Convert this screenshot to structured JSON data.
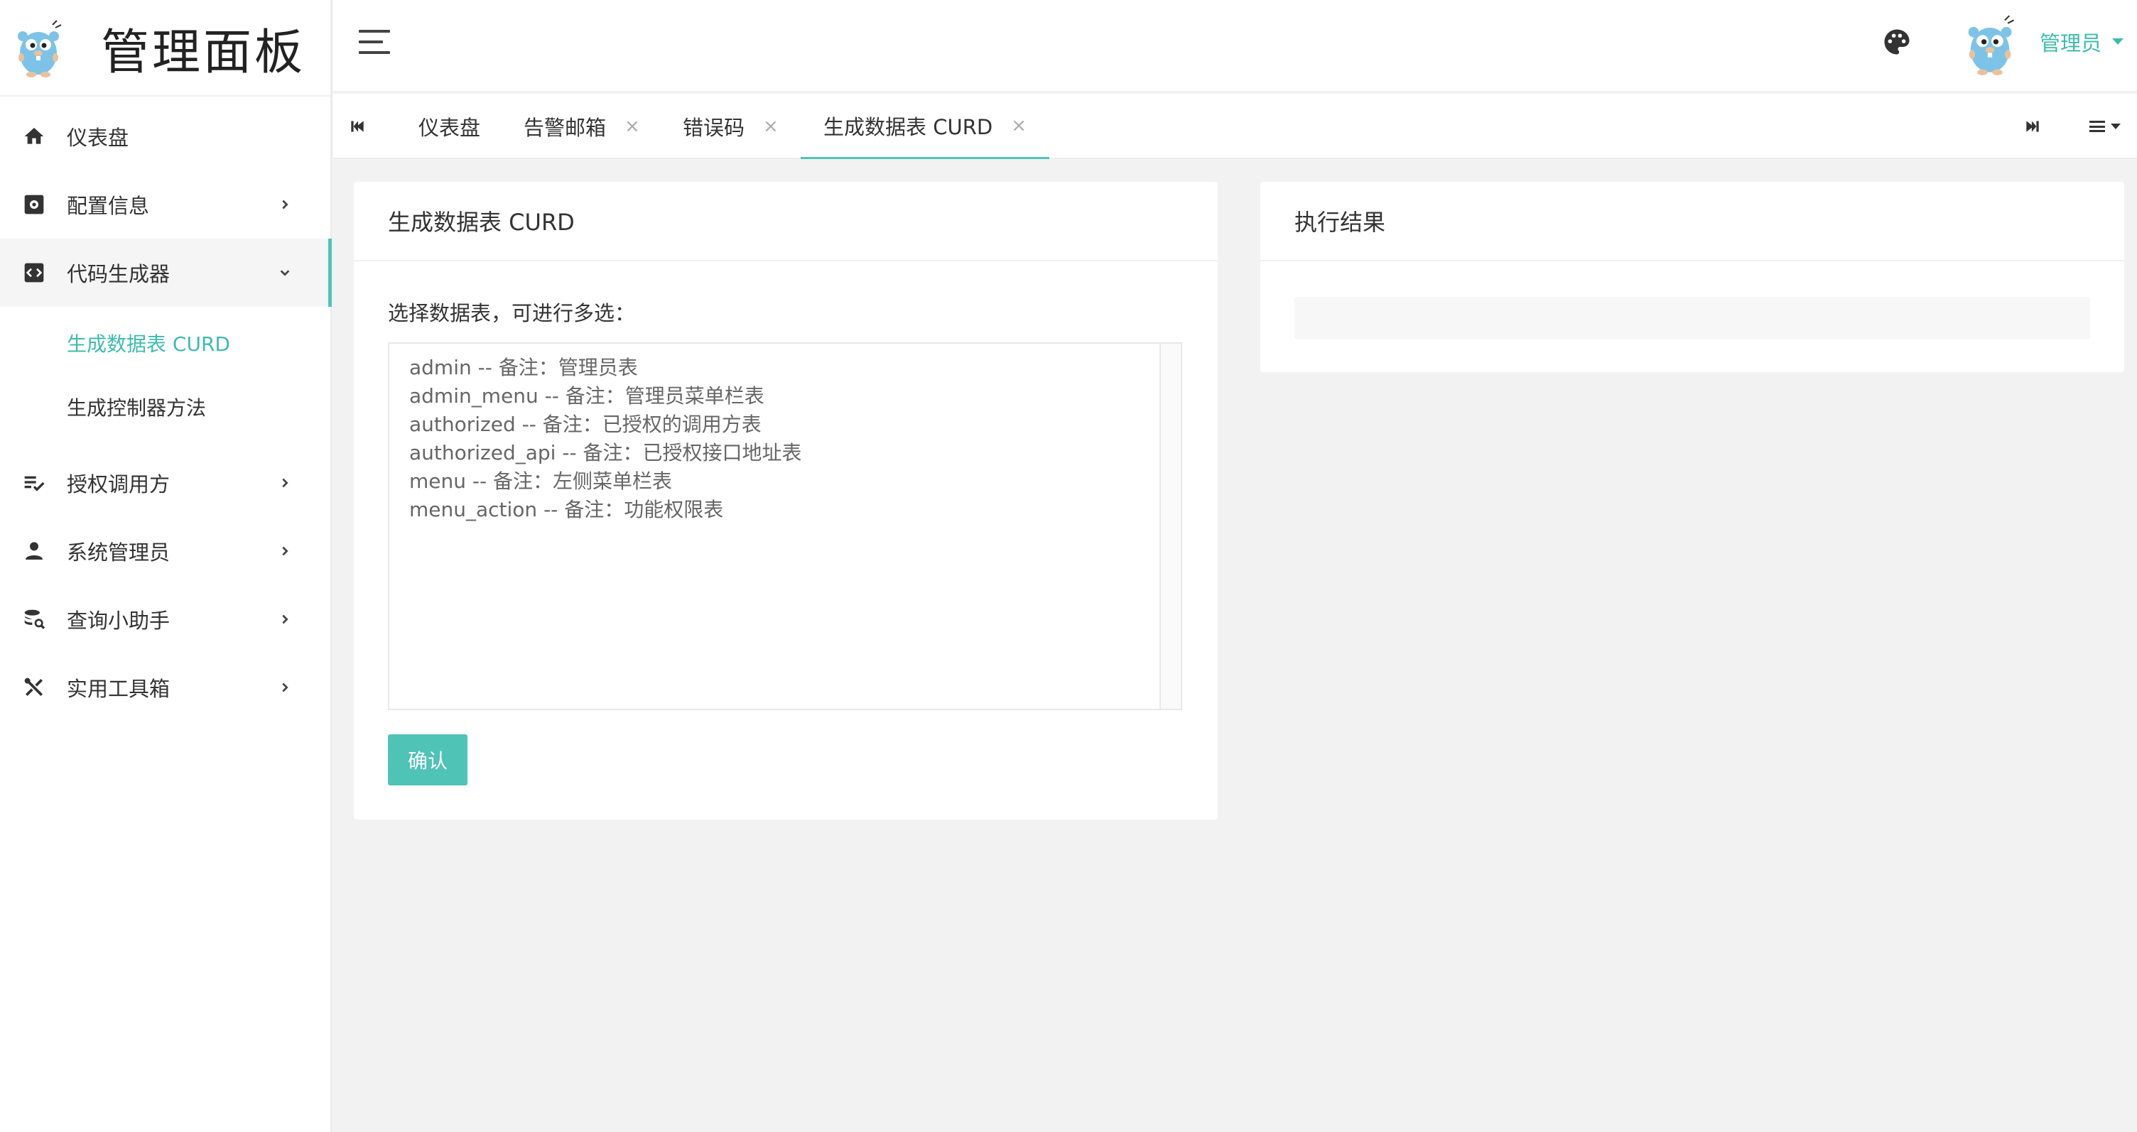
{
  "sidebar": {
    "title": "管理面板",
    "items": [
      {
        "label": "仪表盘"
      },
      {
        "label": "配置信息"
      },
      {
        "label": "代码生成器"
      },
      {
        "label": "授权调用方"
      },
      {
        "label": "系统管理员"
      },
      {
        "label": "查询小助手"
      },
      {
        "label": "实用工具箱"
      }
    ],
    "code_gen_children": [
      {
        "label": "生成数据表 CURD"
      },
      {
        "label": "生成控制器方法"
      }
    ]
  },
  "header": {
    "user_name": "管理员"
  },
  "tabs": [
    {
      "label": "仪表盘"
    },
    {
      "label": "告警邮箱",
      "close": "×"
    },
    {
      "label": "错误码",
      "close": "×"
    },
    {
      "label": "生成数据表 CURD",
      "close": "×"
    }
  ],
  "main": {
    "left_card": {
      "title": "生成数据表 CURD",
      "field_label": "选择数据表，可进行多选：",
      "options": [
        "admin -- 备注：管理员表",
        "admin_menu -- 备注：管理员菜单栏表",
        "authorized -- 备注：已授权的调用方表",
        "authorized_api -- 备注：已授权接口地址表",
        "menu -- 备注：左侧菜单栏表",
        "menu_action -- 备注：功能权限表"
      ],
      "confirm_label": "确认"
    },
    "right_card": {
      "title": "执行结果"
    }
  },
  "colors": {
    "accent": "#4fc3b6",
    "accent_text": "#3fbbad"
  }
}
